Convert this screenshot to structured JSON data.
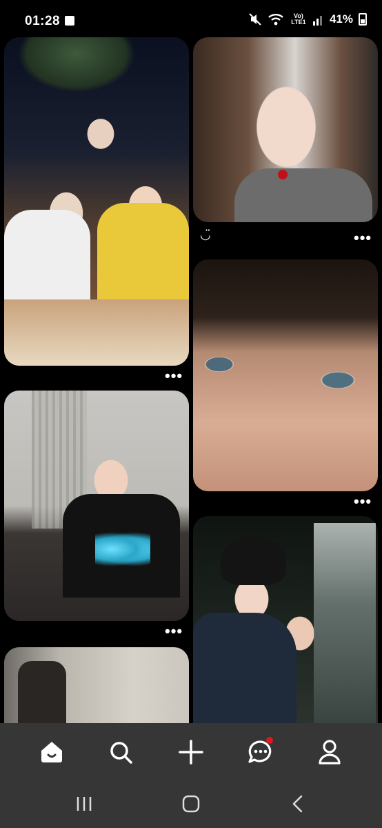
{
  "status_bar": {
    "time": "01:28",
    "network_label": "Vo) LTE1",
    "battery_percent": "41%",
    "icons": [
      "checklist-icon",
      "mute-icon",
      "wifi-icon",
      "signal-icon",
      "battery-icon"
    ]
  },
  "feed": {
    "pins": [
      {
        "id": "pin-1",
        "description_icon": "photo",
        "has_more": true
      },
      {
        "id": "pin-2",
        "has_more": true,
        "caption": "◡̈"
      },
      {
        "id": "pin-3",
        "has_more": true
      },
      {
        "id": "pin-4",
        "has_more": true
      },
      {
        "id": "pin-5",
        "has_more": false
      },
      {
        "id": "pin-6",
        "has_more": false
      }
    ],
    "more_label": "•••"
  },
  "bottom_nav": {
    "items": [
      {
        "name": "home",
        "icon": "home-icon",
        "active": true
      },
      {
        "name": "search",
        "icon": "search-icon",
        "active": false
      },
      {
        "name": "create",
        "icon": "plus-icon",
        "active": false
      },
      {
        "name": "messages",
        "icon": "chat-icon",
        "active": false,
        "notification": true
      },
      {
        "name": "profile",
        "icon": "profile-icon",
        "active": false
      }
    ]
  },
  "system_nav": {
    "items": [
      "recent-apps-icon",
      "home-circle-icon",
      "back-icon"
    ]
  },
  "colors": {
    "background": "#000000",
    "nav_background": "#363636",
    "notification_dot": "#e3161e"
  }
}
